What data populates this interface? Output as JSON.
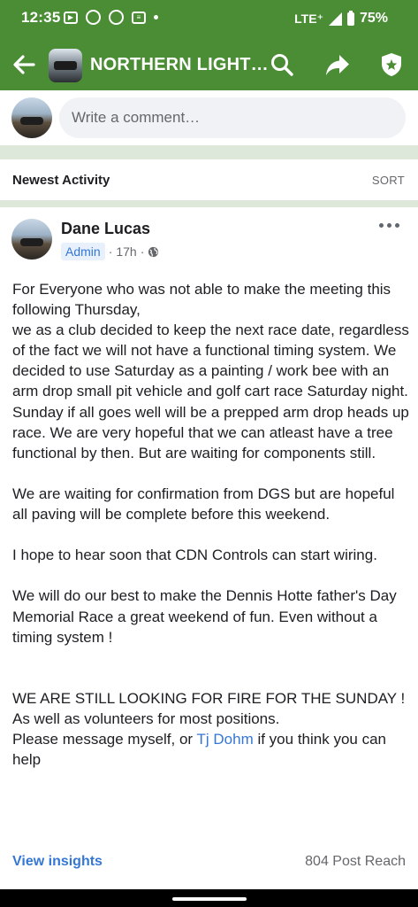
{
  "status_bar": {
    "time": "12:35",
    "network": "LTE⁺",
    "battery": "75%",
    "notification_icons": [
      "youtube-icon",
      "podcast-icon",
      "sirius-icon",
      "news-icon"
    ]
  },
  "app_bar": {
    "title": "NORTHERN LIGHT…",
    "icons": [
      "back-arrow-icon",
      "search-icon",
      "share-icon",
      "admin-shield-icon"
    ]
  },
  "composer": {
    "placeholder": "Write a comment…"
  },
  "activity": {
    "label": "Newest Activity",
    "sort_label": "SORT"
  },
  "post": {
    "author": "Dane Lucas",
    "badge": "Admin",
    "time": "17h",
    "separator": "·",
    "privacy_icon": "globe-icon",
    "body": {
      "p1": [
        "For Everyone who was not able to make the meeting this following Thursday,",
        "we as a club decided to keep the next race date, regardless of the fact we will not have a functional timing system. We decided to use Saturday as a painting / work bee with an arm drop small pit vehicle and golf cart race Saturday night.",
        "Sunday if all goes well will be a prepped arm drop heads up race. We are very hopeful that we can atleast have a tree functional by then. But are waiting for components still."
      ],
      "p2": "We are waiting for confirmation from DGS but are hopeful all paving will be complete before this weekend.",
      "p3": "I hope to hear soon that CDN Controls can start wiring.",
      "p4": "We will do our best to make the Dennis Hotte father's Day Memorial Race a great weekend of fun. Even without a timing system !",
      "p5": [
        "WE ARE STILL LOOKING FOR FIRE FOR THE SUNDAY !",
        "As well as volunteers for most positions."
      ],
      "p6_before": "Please message myself, or ",
      "p6_mention": "Tj Dohm",
      "p6_after": " if you think you can help"
    },
    "insights_label": "View insights",
    "reach": "804 Post Reach"
  },
  "colors": {
    "brand_green": "#4a8d34",
    "link_blue": "#3577d4",
    "divider": "#dde7da"
  }
}
